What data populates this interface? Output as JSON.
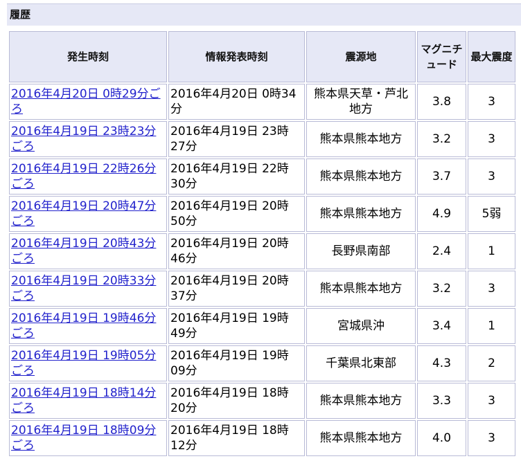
{
  "section": {
    "title": "履歴"
  },
  "table": {
    "headers": {
      "time": "発生時刻",
      "announce": "情報発表時刻",
      "place": "震源地",
      "magnitude": "マグニチュード",
      "intensity": "最大震度"
    },
    "rows": [
      {
        "time": "2016年4月20日 0時29分ごろ",
        "announce": "2016年4月20日 0時34分",
        "place": "熊本県天草・芦北地方",
        "magnitude": "3.8",
        "intensity": "3"
      },
      {
        "time": "2016年4月19日 23時23分ごろ",
        "announce": "2016年4月19日 23時27分",
        "place": "熊本県熊本地方",
        "magnitude": "3.2",
        "intensity": "3"
      },
      {
        "time": "2016年4月19日 22時26分ごろ",
        "announce": "2016年4月19日 22時30分",
        "place": "熊本県熊本地方",
        "magnitude": "3.7",
        "intensity": "3"
      },
      {
        "time": "2016年4月19日 20時47分ごろ",
        "announce": "2016年4月19日 20時50分",
        "place": "熊本県熊本地方",
        "magnitude": "4.9",
        "intensity": "5弱"
      },
      {
        "time": "2016年4月19日 20時43分ごろ",
        "announce": "2016年4月19日 20時46分",
        "place": "長野県南部",
        "magnitude": "2.4",
        "intensity": "1"
      },
      {
        "time": "2016年4月19日 20時33分ごろ",
        "announce": "2016年4月19日 20時37分",
        "place": "熊本県熊本地方",
        "magnitude": "3.2",
        "intensity": "3"
      },
      {
        "time": "2016年4月19日 19時46分ごろ",
        "announce": "2016年4月19日 19時49分",
        "place": "宮城県沖",
        "magnitude": "3.4",
        "intensity": "1"
      },
      {
        "time": "2016年4月19日 19時05分ごろ",
        "announce": "2016年4月19日 19時09分",
        "place": "千葉県北東部",
        "magnitude": "4.3",
        "intensity": "2"
      },
      {
        "time": "2016年4月19日 18時14分ごろ",
        "announce": "2016年4月19日 18時20分",
        "place": "熊本県熊本地方",
        "magnitude": "3.3",
        "intensity": "3"
      },
      {
        "time": "2016年4月19日 18時09分ごろ",
        "announce": "2016年4月19日 18時12分",
        "place": "熊本県熊本地方",
        "magnitude": "4.0",
        "intensity": "3"
      }
    ]
  },
  "colors": {
    "header_bg": "#e6e8f6",
    "border": "#b8bad6",
    "link": "#2222cc"
  }
}
